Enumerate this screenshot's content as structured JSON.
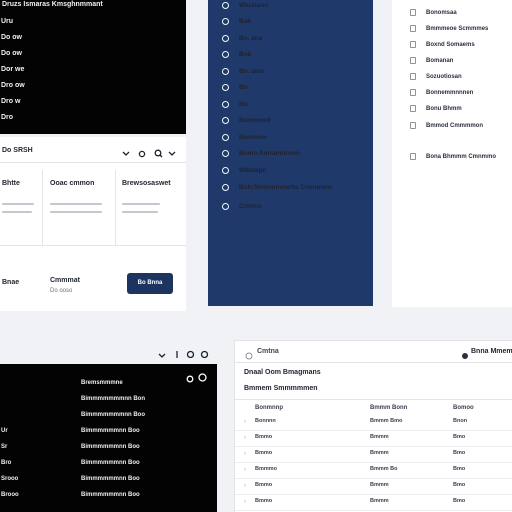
{
  "terminal_top": {
    "title": "Druzs Ismaras Kmsghnmmant",
    "lines": [
      "Uru",
      "Do ow",
      "Do ow",
      "Dor we",
      "Dro ow",
      "Dro w",
      "Dro"
    ]
  },
  "form_card": {
    "header": "Do SRSH",
    "col1_label": "Bhtte",
    "col2_label": "Ooac cmmon",
    "col3_label": "Brewsosaswet",
    "footer_label": "Bnae",
    "footer_center_title": "Cmmmat",
    "footer_center_sub": "Do ooso",
    "primary_button": "Bo Bnna"
  },
  "nav": {
    "items": [
      {
        "label": "Wiustann"
      },
      {
        "label": "Ba6"
      },
      {
        "label": "Bo. ana"
      },
      {
        "label": "Bo8"
      },
      {
        "label": "Bo. ams"
      },
      {
        "label": "Bo"
      },
      {
        "label": "Bo"
      },
      {
        "label": "Bemmoed"
      },
      {
        "label": "Bemmoe"
      },
      {
        "label": "Bomo Amrambronn"
      },
      {
        "label": "Wibbapn"
      },
      {
        "label": "Boh:Smmmmmetta Cmmmem"
      },
      {
        "label": "Crmtco"
      }
    ]
  },
  "list_panel": {
    "items": [
      {
        "label": "Bonomsaa"
      },
      {
        "label": "Bmmmeoe Scmmmes"
      },
      {
        "label": "Boxnd Somaems"
      },
      {
        "label": "Bomanan"
      },
      {
        "label": "Sozuotiosan"
      },
      {
        "label": "Bonnemmnnnen"
      },
      {
        "label": "Bonu Bhmm"
      },
      {
        "label": "Bmmod Cmmmmon"
      },
      {
        "label": "Bona Bhmmm Cmnmmo"
      }
    ]
  },
  "terminal_bottom": {
    "lines": [
      "Bremsmmmne",
      "Bimmmmmmmnn Bon",
      "Bimmmmmmmnn Boo",
      "Bimmmmmmnn Boo",
      "Bimmmmmmnn Boo",
      "Bimmmmmmnn Boo",
      "Bimmmmmmnn Boo",
      "Bimmmmmmnn Boo"
    ],
    "left_tags": [
      "Ur",
      "Sr",
      "Bro",
      "Srooo",
      "Brooo"
    ]
  },
  "table_card": {
    "header_left": "Cmtna",
    "header_right": "Bnna Mmemsa",
    "title": "Dnaal Oom Bmagmans",
    "subtitle": "Bmmem Smmmmmen",
    "columns": [
      "Bonmnnp",
      "Bmmm Bonn",
      "Bomoo"
    ],
    "rows": [
      [
        "Bonnnn",
        "Bmmm Bmo",
        "Bnon"
      ],
      [
        "Bmmo",
        "Bmmm",
        "Bmo"
      ],
      [
        "Bmmo",
        "Bmmm",
        "Bmo"
      ],
      [
        "Bmmmo",
        "Bmmm Bo",
        "Bmo"
      ],
      [
        "Bmmo",
        "Bmmm",
        "Bmo"
      ],
      [
        "Bmmo",
        "Bmmm",
        "Bmo"
      ]
    ]
  }
}
